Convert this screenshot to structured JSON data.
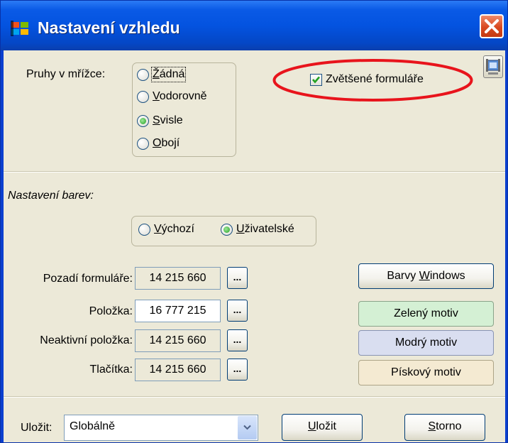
{
  "window": {
    "title": "Nastavení vzhledu",
    "icons": {
      "app": "windows-flag-icon",
      "close": "close-icon",
      "side": "film-settings-icon"
    }
  },
  "grid_stripes": {
    "label": "Pruhy v mřížce:",
    "options": [
      {
        "label": "Žádná",
        "accel": "Ž",
        "rest": "ádná",
        "selected": false
      },
      {
        "label": "Vodorovně",
        "accel": "V",
        "rest": "odorovně",
        "selected": false
      },
      {
        "label": "Svisle",
        "accel": "S",
        "rest": "visle",
        "selected": true
      },
      {
        "label": "Obojí",
        "accel": "O",
        "rest": "bojí",
        "selected": false
      }
    ]
  },
  "enlarged_forms": {
    "label": "Zvětšené formuláře",
    "checked": true
  },
  "colors": {
    "heading": "Nastavení barev:",
    "modes": [
      {
        "label": "Výchozí",
        "accel": "V",
        "rest": "ýchozí",
        "selected": false
      },
      {
        "label": "Uživatelské",
        "accel": "U",
        "rest": "živatelské",
        "selected": true
      }
    ],
    "rows": [
      {
        "label": "Pozadí formuláře:",
        "value": "14 215 660",
        "button": "..."
      },
      {
        "label": "Položka:",
        "value": "16 777 215",
        "button": "..."
      },
      {
        "label": "Neaktivní položka:",
        "value": "14 215 660",
        "button": "..."
      },
      {
        "label": "Tlačítka:",
        "value": "14 215 660",
        "button": "..."
      }
    ],
    "windows_button": {
      "pre": "Barvy ",
      "accel": "W",
      "post": "indows"
    },
    "themes": [
      {
        "label": "Zelený motiv",
        "color": "#d4f0d4"
      },
      {
        "label": "Modrý motiv",
        "color": "#d9def0"
      },
      {
        "label": "Pískový motiv",
        "color": "#f4ead2"
      }
    ]
  },
  "footer": {
    "save_label": "Uložit:",
    "save_value": "Globálně",
    "ok_button": {
      "accel": "U",
      "rest": "ložit"
    },
    "cancel_button": {
      "accel": "S",
      "rest": "torno"
    }
  },
  "annotation": {
    "color": "#e8141c"
  }
}
